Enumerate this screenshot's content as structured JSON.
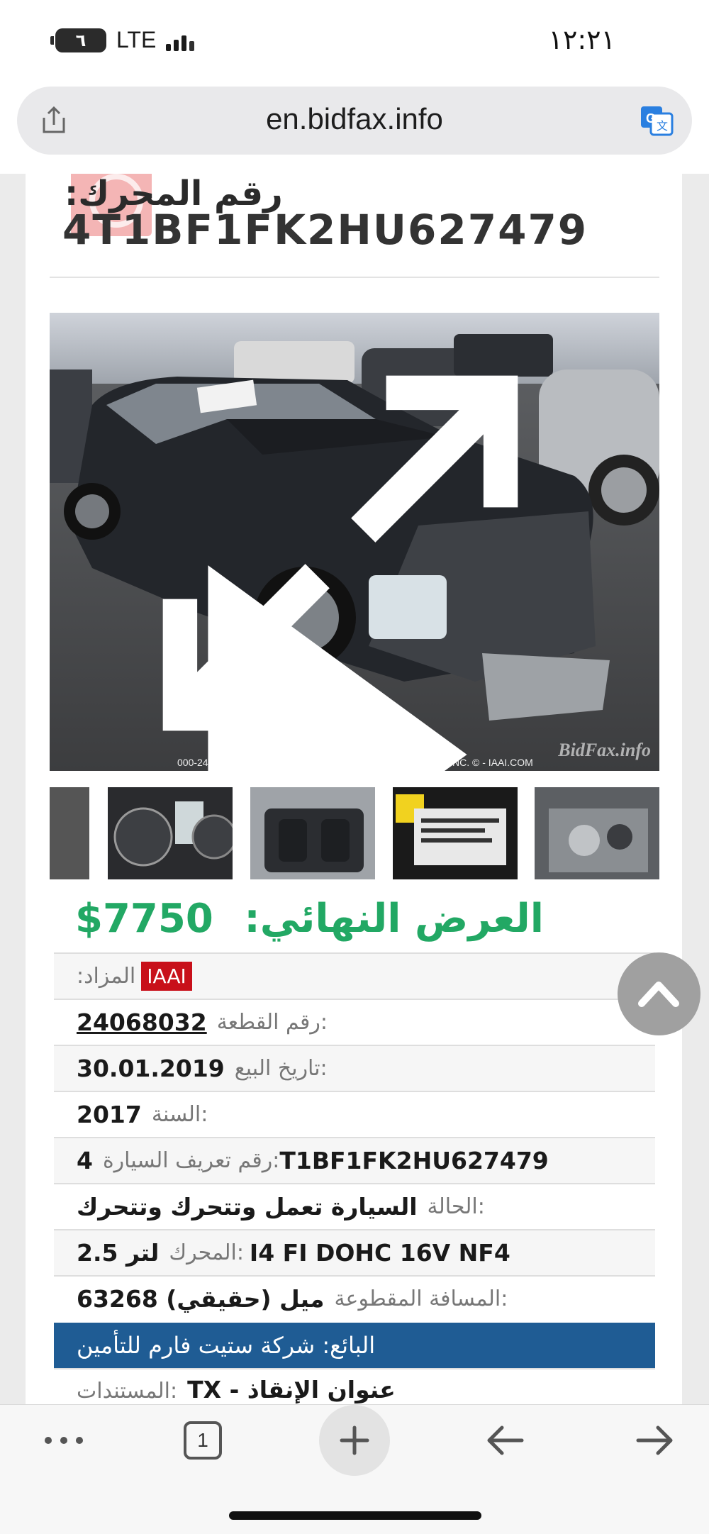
{
  "status_bar": {
    "battery": "٦",
    "network": "LTE",
    "time": "١٢:٢١"
  },
  "browser": {
    "url": "en.bidfax.info",
    "tab_count": "1"
  },
  "listing": {
    "engine_title": "رقم المحرك:",
    "engine_vin": "4T1BF1FK2HU627479",
    "photo_caption": "000-24068032 - 12/26/2018 INSURANCE AUTO AUCTIONS, INC. © - IAAI.COM",
    "photo_watermark": "BidFax.info",
    "final_bid_label": "العرض النهائي:",
    "final_bid_value": "7750$"
  },
  "details": {
    "auction_label": ":المزاد",
    "auction_value": "IAAI",
    "lot_label": "رقم القطعة:",
    "lot_value": "24068032",
    "sale_date_label": "تاريخ البيع:",
    "sale_date_value": "30.01.2019",
    "year_label": "السنة:",
    "year_value": "2017",
    "vin_label": "رقم تعريف السيارة:",
    "vin_value_prefix": "4",
    "vin_value": "T1BF1FK2HU627479",
    "condition_label": "الحالة:",
    "condition_value": "السيارة تعمل وتتحرك وتتحرك",
    "engine_label": "المحرك:",
    "engine_size": "2.5 لتر",
    "engine_value": "I4 FI DOHC 16V NF4",
    "mileage_label": "المسافة المقطوعة:",
    "mileage_value": "63268 ميل (حقيقي)",
    "seller_text": "البائع: شركة ستيت فارم للتأمين",
    "docs_label": "المستندات:",
    "docs_value": "TX - عنوان الإنقاذ"
  },
  "colors": {
    "accent_green": "#22a864",
    "seller_blue": "#1f5c94",
    "iaai_red": "#c8101a"
  },
  "icons": [
    "share-icon",
    "translate-icon",
    "expand-icon",
    "next-arrow-icon",
    "scroll-top-icon",
    "more-icon",
    "plus-icon",
    "back-arrow-icon",
    "forward-arrow-icon"
  ]
}
